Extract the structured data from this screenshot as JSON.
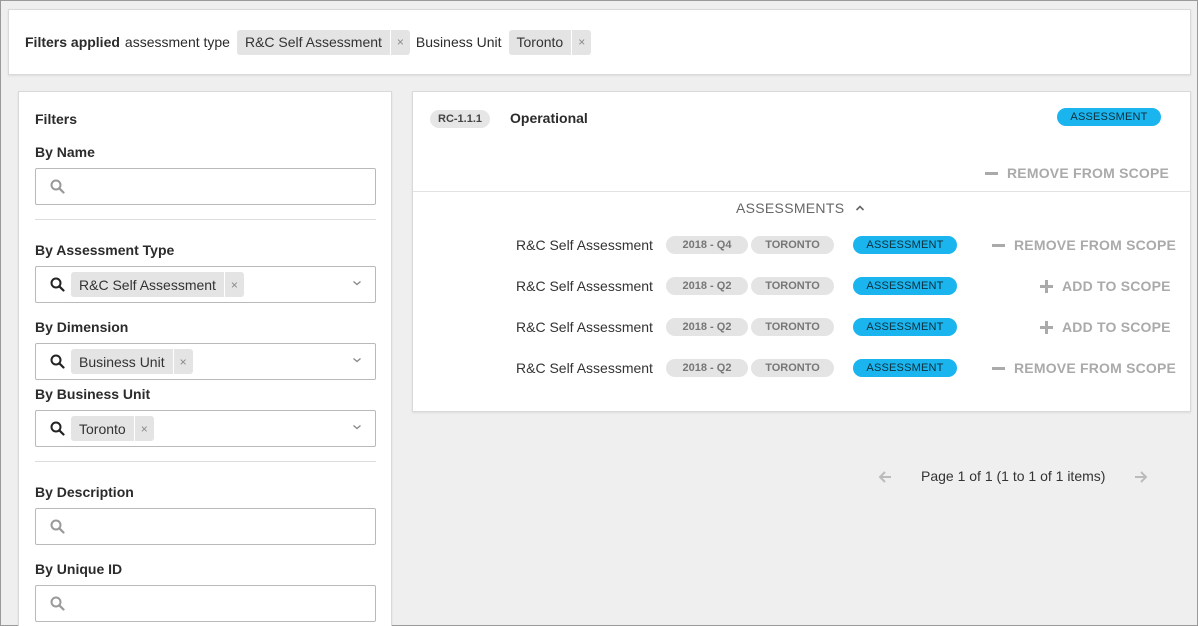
{
  "filters_bar": {
    "label": "Filters applied",
    "assessment_type_label": "assessment type",
    "assessment_type_chip": "R&C Self Assessment",
    "business_unit_label": "Business Unit",
    "business_unit_chip": "Toronto",
    "remove_glyph": "×"
  },
  "sidebar": {
    "title": "Filters",
    "by_name": {
      "label": "By Name",
      "value": ""
    },
    "by_assessment_type": {
      "label": "By Assessment Type",
      "chip": "R&C Self Assessment"
    },
    "by_dimension": {
      "label": "By Dimension",
      "chip": "Business Unit"
    },
    "by_business_unit": {
      "label": "By Business Unit",
      "chip": "Toronto"
    },
    "by_description": {
      "label": "By Description",
      "value": ""
    },
    "by_unique_id": {
      "label": "By Unique ID",
      "value": ""
    }
  },
  "record": {
    "id_badge": "RC-1.1.1",
    "title": "Operational",
    "type_badge": "ASSESSMENT",
    "action": "REMOVE FROM SCOPE",
    "section_header": "ASSESSMENTS",
    "rows": [
      {
        "name": "R&C Self Assessment",
        "period": "2018 - Q4",
        "location": "TORONTO",
        "type": "ASSESSMENT",
        "action": "REMOVE FROM SCOPE",
        "action_kind": "remove"
      },
      {
        "name": "R&C Self Assessment",
        "period": "2018 - Q2",
        "location": "TORONTO",
        "type": "ASSESSMENT",
        "action": "ADD TO SCOPE",
        "action_kind": "add"
      },
      {
        "name": "R&C Self Assessment",
        "period": "2018 - Q2",
        "location": "TORONTO",
        "type": "ASSESSMENT",
        "action": "ADD TO SCOPE",
        "action_kind": "add"
      },
      {
        "name": "R&C Self Assessment",
        "period": "2018 - Q2",
        "location": "TORONTO",
        "type": "ASSESSMENT",
        "action": "REMOVE FROM SCOPE",
        "action_kind": "remove"
      }
    ]
  },
  "pagination": {
    "text": "Page 1 of 1 (1 to 1 of 1 items)"
  },
  "colors": {
    "accent_blue": "#1ab4ee",
    "muted": "#aaaaaa"
  }
}
